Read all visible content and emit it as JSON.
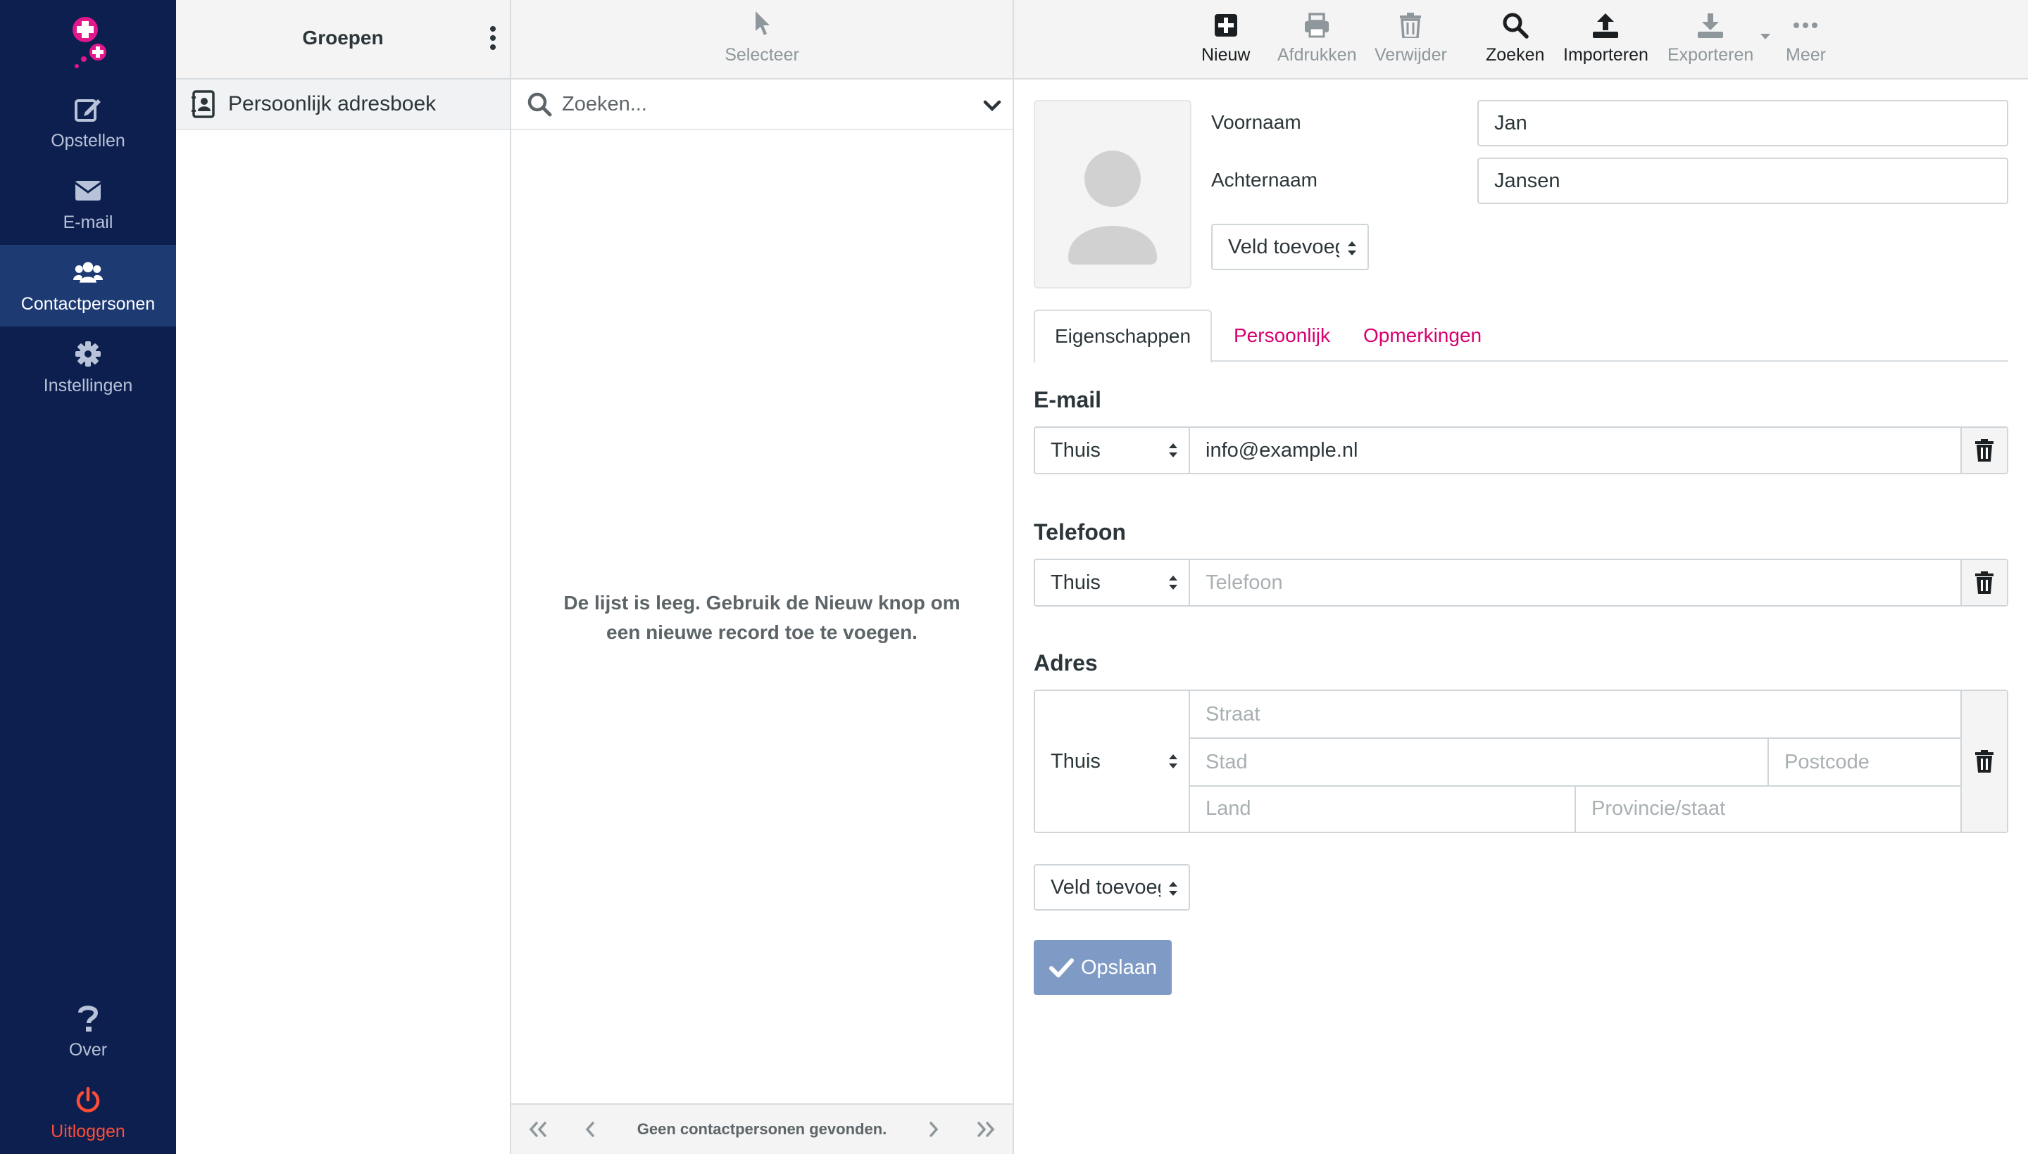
{
  "nav": {
    "items": [
      {
        "label": "Opstellen",
        "icon": "compose-icon"
      },
      {
        "label": "E-mail",
        "icon": "envelope-icon"
      },
      {
        "label": "Contactpersonen",
        "icon": "users-icon"
      },
      {
        "label": "Instellingen",
        "icon": "gear-icon"
      }
    ],
    "bottom": [
      {
        "label": "Over",
        "icon": "question-icon"
      },
      {
        "label": "Uitloggen",
        "icon": "power-icon"
      }
    ],
    "colors": {
      "background": "#0c1f4e",
      "active": "#1d3a73",
      "logout": "#ff4d38",
      "brand": "#e3178b"
    }
  },
  "groups": {
    "title": "Groepen",
    "addressbook": "Persoonlijk adresboek"
  },
  "list": {
    "select_label": "Selecteer",
    "search_placeholder": "Zoeken...",
    "empty_message": "De lijst is leeg. Gebruik de Nieuw knop om een nieuwe record toe te voegen.",
    "pager_count": "Geen contactpersonen gevonden."
  },
  "toolbar": {
    "nieuw": "Nieuw",
    "afdrukken": "Afdrukken",
    "verwijder": "Verwijder",
    "zoeken": "Zoeken",
    "importeren": "Importeren",
    "exporteren": "Exporteren",
    "meer": "Meer"
  },
  "form": {
    "voornaam_label": "Voornaam",
    "voornaam_value": "Jan",
    "achternaam_label": "Achternaam",
    "achternaam_value": "Jansen",
    "add_field_label": "Veld toevoegen...",
    "tabs": [
      "Eigenschappen",
      "Persoonlijk",
      "Opmerkingen"
    ],
    "email": {
      "title": "E-mail",
      "type": "Thuis",
      "value": "info@example.nl"
    },
    "phone": {
      "title": "Telefoon",
      "type": "Thuis",
      "placeholder": "Telefoon"
    },
    "address": {
      "title": "Adres",
      "type": "Thuis",
      "street_placeholder": "Straat",
      "city_placeholder": "Stad",
      "postcode_placeholder": "Postcode",
      "country_placeholder": "Land",
      "region_placeholder": "Provincie/staat"
    },
    "add_field_bottom": "Veld toevoegen...",
    "save_label": "Opslaan",
    "accent": "#d6006f"
  }
}
